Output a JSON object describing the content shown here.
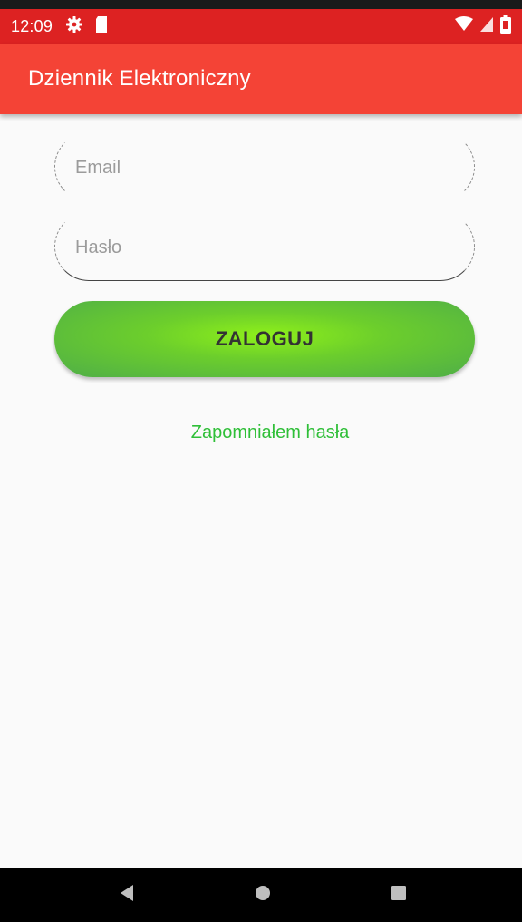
{
  "status_bar": {
    "time": "12:09",
    "icons": [
      "gear-icon",
      "sd-card-icon",
      "wifi-icon",
      "signal-icon",
      "battery-icon"
    ]
  },
  "app_bar": {
    "title": "Dziennik Elektroniczny",
    "color": "#f44336"
  },
  "login_form": {
    "email_placeholder": "Email",
    "email_value": "",
    "password_placeholder": "Hasło",
    "password_value": "",
    "login_button_label": "ZALOGUJ",
    "forgot_password_link": "Zapomniałem hasła"
  },
  "colors": {
    "status_bar": "#dd2222",
    "accent_green": "#2fbf38",
    "button_gradient_center": "#8ef01a",
    "button_gradient_edge": "#4fae48"
  },
  "nav_bar": {
    "icons": [
      "back-icon",
      "home-icon",
      "recents-icon"
    ]
  }
}
